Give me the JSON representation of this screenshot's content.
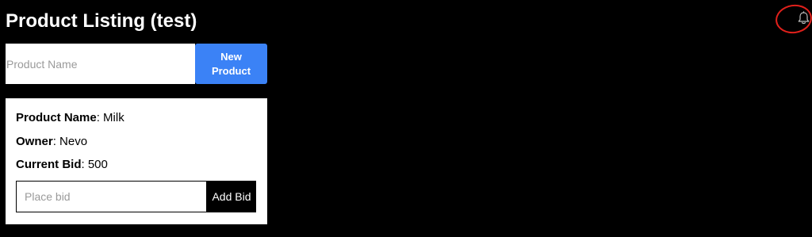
{
  "header": {
    "title": "Product Listing (test)",
    "notifications_icon": "bell-icon",
    "annotation_color": "#e0201b"
  },
  "new_product": {
    "input_placeholder": "Product Name",
    "input_value": "",
    "button_label": "New Product",
    "button_color": "#3b82f6"
  },
  "products": [
    {
      "name_label": "Product Name",
      "name": "Milk",
      "owner_label": "Owner",
      "owner": "Nevo",
      "bid_label": "Current Bid",
      "current_bid": "500",
      "separator": ":",
      "bid_placeholder": "Place bid",
      "bid_value": "",
      "add_bid_label": "Add Bid"
    }
  ]
}
